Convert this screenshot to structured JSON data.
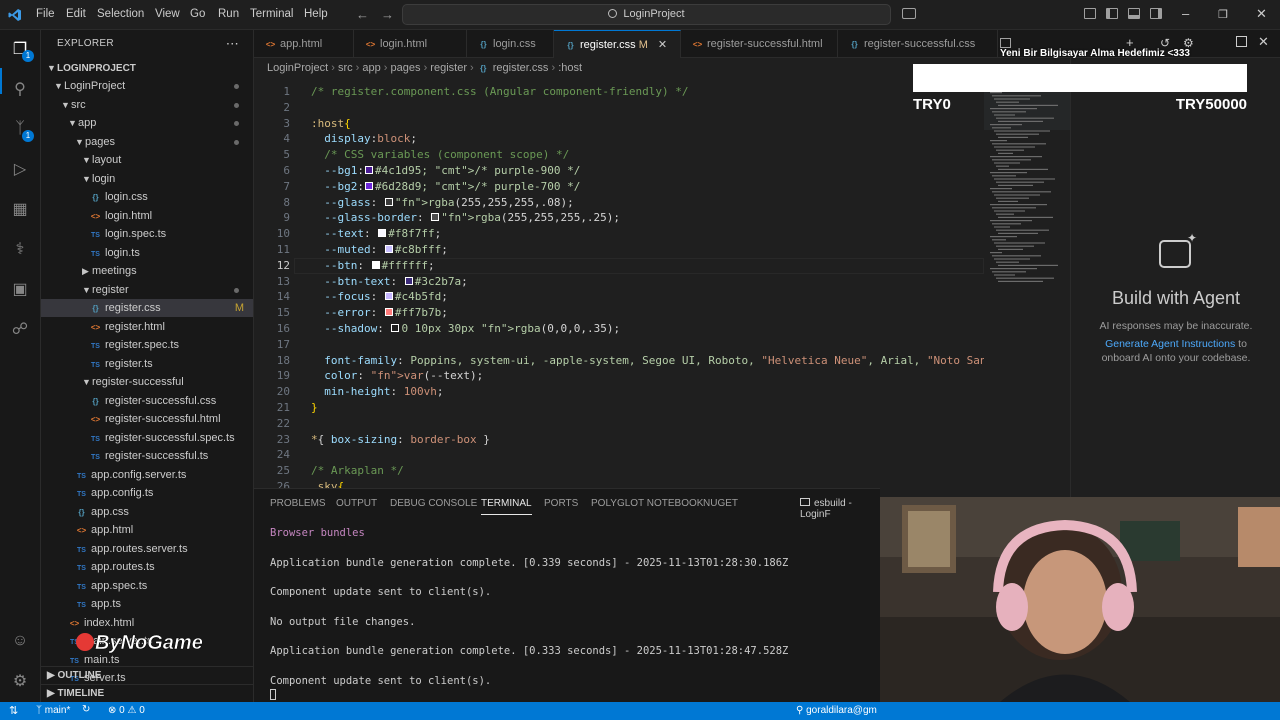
{
  "titlebar": {
    "menus": [
      "File",
      "Edit",
      "Selection",
      "View",
      "Go",
      "Run",
      "Terminal",
      "Help"
    ],
    "search": "LoginProject"
  },
  "sidebar": {
    "title": "EXPLORER",
    "project": "LOGINPROJECT",
    "tree": [
      {
        "label": "LoginProject",
        "kind": "folder",
        "indent": 1
      },
      {
        "label": "src",
        "kind": "folder",
        "indent": 2
      },
      {
        "label": "app",
        "kind": "folder",
        "indent": 3
      },
      {
        "label": "pages",
        "kind": "folder",
        "indent": 4
      },
      {
        "label": "layout",
        "kind": "folder",
        "indent": 5
      },
      {
        "label": "login",
        "kind": "folder",
        "indent": 5
      },
      {
        "label": "login.css",
        "kind": "css",
        "indent": 6
      },
      {
        "label": "login.html",
        "kind": "html",
        "indent": 6
      },
      {
        "label": "login.spec.ts",
        "kind": "ts",
        "indent": 6
      },
      {
        "label": "login.ts",
        "kind": "ts",
        "indent": 6
      },
      {
        "label": "meetings",
        "kind": "folder-closed",
        "indent": 5
      },
      {
        "label": "register",
        "kind": "folder",
        "indent": 5
      },
      {
        "label": "register.css",
        "kind": "css",
        "indent": 6
      },
      {
        "label": "register.html",
        "kind": "html",
        "indent": 6
      },
      {
        "label": "register.spec.ts",
        "kind": "ts",
        "indent": 6
      },
      {
        "label": "register.ts",
        "kind": "ts",
        "indent": 6
      },
      {
        "label": "register-successful",
        "kind": "folder",
        "indent": 5
      },
      {
        "label": "register-successful.css",
        "kind": "css",
        "indent": 6
      },
      {
        "label": "register-successful.html",
        "kind": "html",
        "indent": 6
      },
      {
        "label": "register-successful.spec.ts",
        "kind": "ts",
        "indent": 6
      },
      {
        "label": "register-successful.ts",
        "kind": "ts",
        "indent": 6
      },
      {
        "label": "app.config.server.ts",
        "kind": "ts",
        "indent": 4
      },
      {
        "label": "app.config.ts",
        "kind": "ts",
        "indent": 4
      },
      {
        "label": "app.css",
        "kind": "css",
        "indent": 4
      },
      {
        "label": "app.html",
        "kind": "html",
        "indent": 4
      },
      {
        "label": "app.routes.server.ts",
        "kind": "ts",
        "indent": 4
      },
      {
        "label": "app.routes.ts",
        "kind": "ts",
        "indent": 4
      },
      {
        "label": "app.spec.ts",
        "kind": "ts",
        "indent": 4
      },
      {
        "label": "app.ts",
        "kind": "ts",
        "indent": 4
      },
      {
        "label": "index.html",
        "kind": "html",
        "indent": 3
      },
      {
        "label": "main.server.ts",
        "kind": "ts",
        "indent": 3
      },
      {
        "label": "main.ts",
        "kind": "ts",
        "indent": 3
      },
      {
        "label": "server.ts",
        "kind": "ts",
        "indent": 3
      }
    ],
    "modified_marker": "M",
    "outline": "OUTLINE",
    "timeline": "TIMELINE"
  },
  "tabs": [
    {
      "label": "app.html",
      "kind": "html"
    },
    {
      "label": "login.html",
      "kind": "html"
    },
    {
      "label": "login.css",
      "kind": "css"
    },
    {
      "label": "register.css",
      "kind": "css",
      "active": true,
      "mod": "M"
    },
    {
      "label": "register-successful.html",
      "kind": "html"
    },
    {
      "label": "register-successful.css",
      "kind": "css"
    }
  ],
  "breadcrumb": [
    "LoginProject",
    "src",
    "app",
    "pages",
    "register",
    "register.css",
    ":host"
  ],
  "editor": {
    "current_line": 12,
    "lines": [
      "/* register.component.css (Angular component-friendly) */",
      "",
      ":host{",
      "  display:block;",
      "  /* CSS variables (component scope) */",
      "  --bg1:#4c1d95; /* purple-900 */",
      "  --bg2:#6d28d9; /* purple-700 */",
      "  --glass: rgba(255,255,255,.08);",
      "  --glass-border: rgba(255,255,255,.25);",
      "  --text: #f8f7ff;",
      "  --muted: #c8bfff;",
      "  --btn: #ffffff;",
      "  --btn-text: #3c2b7a;",
      "  --focus: #c4b5fd;",
      "  --error: #ff7b7b;",
      "  --shadow: 0 10px 30px rgba(0,0,0,.35);",
      "",
      "  font-family: Poppins, system-ui, -apple-system, Segoe UI, Roboto, \"Helvetica Neue\", Arial, \"Noto Sans\"",
      "  color: var(--text);",
      "  min-height: 100vh;",
      "}",
      "",
      "*{ box-sizing: border-box }",
      "",
      "/* Arkaplan */",
      ".sky{"
    ],
    "swatches": {
      "6": "#4c1d95",
      "7": "#6d28d9",
      "8": "#3a3a3a",
      "9": "#4d4d4d",
      "10": "#f8f7ff",
      "11": "#c8bfff",
      "12": "#ffffff",
      "13": "#3c2b7a",
      "14": "#c4b5fd",
      "15": "#ff7b7b",
      "16": "#1f1f1f"
    }
  },
  "overlay": {
    "goal_text": "Yeni Bir Bilgisayar Alma Hedefimiz <333",
    "goal_start": "TRY0",
    "goal_end": "TRY50000",
    "goal_progress": 0
  },
  "agent": {
    "title": "Build with Agent",
    "disclaimer": "AI responses may be inaccurate.",
    "link": "Generate Agent Instructions",
    "link_suffix": " to",
    "line2": "onboard AI onto your codebase."
  },
  "panel": {
    "tabs": [
      "PROBLEMS",
      "OUTPUT",
      "DEBUG CONSOLE",
      "TERMINAL",
      "PORTS",
      "POLYGLOT NOTEBOOK",
      "NUGET"
    ],
    "active_tab": "TERMINAL",
    "terminal_name": "esbuild - LoginF",
    "lines": [
      "Browser bundles",
      "Application bundle generation complete. [0.339 seconds] - 2025-11-13T01:28:30.186Z",
      "Component update sent to client(s).",
      "No output file changes.",
      "Application bundle generation complete. [0.333 seconds] - 2025-11-13T01:28:47.528Z",
      "Component update sent to client(s)."
    ]
  },
  "statusbar": {
    "branch": "main*",
    "problems": "0",
    "warnings": "0",
    "user": "goraldilara@gm"
  },
  "watermark": "ByNoGame",
  "colors": {
    "accent": "#0078d4",
    "bg": "#1f1f1f",
    "sidebar": "#181818"
  }
}
